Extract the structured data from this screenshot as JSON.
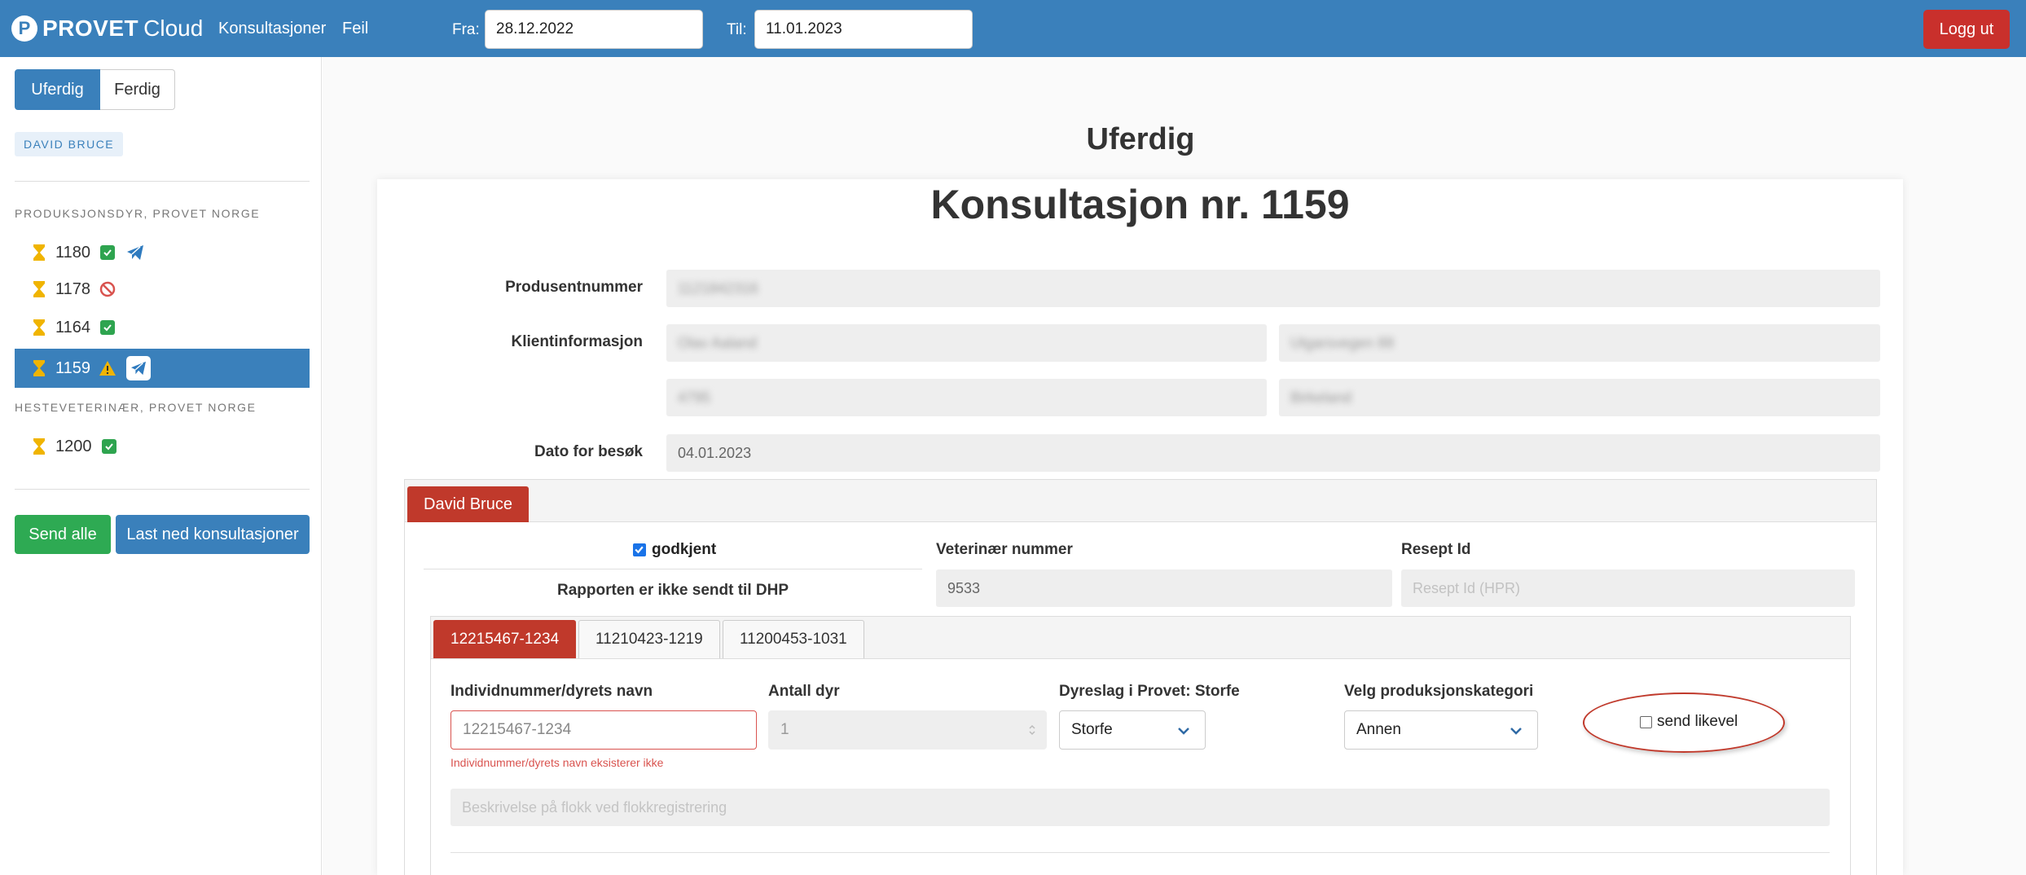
{
  "navbar": {
    "brand_bold": "PROVET",
    "brand_light": "Cloud",
    "logo_letter": "P",
    "links": [
      "Konsultasjoner",
      "Feil"
    ],
    "from_label": "Fra:",
    "from_value": "28.12.2022",
    "to_label": "Til:",
    "to_value": "11.01.2023",
    "logout": "Logg ut"
  },
  "sidebar": {
    "tabs": [
      "Uferdig",
      "Ferdig"
    ],
    "active_tab": "Uferdig",
    "user_tag": "DAVID BRUCE",
    "groups": [
      {
        "title": "PRODUKSJONSDYR, PROVET NORGE",
        "items": [
          {
            "number": "1180",
            "icons": [
              "check-icon",
              "paper-plane-icon"
            ]
          },
          {
            "number": "1178",
            "icons": [
              "prohibited-icon"
            ]
          },
          {
            "number": "1164",
            "icons": [
              "check-icon"
            ]
          },
          {
            "number": "1159",
            "icons": [
              "warning-icon",
              "paper-plane-icon"
            ],
            "active": true
          }
        ]
      },
      {
        "title": "HESTEVETERINÆR, PROVET NORGE",
        "items": [
          {
            "number": "1200",
            "icons": [
              "check-icon"
            ]
          }
        ]
      }
    ],
    "send_all": "Send alle",
    "download": "Last ned konsultasjoner"
  },
  "main": {
    "status_title": "Uferdig",
    "consultation_title": "Konsultasjon nr. 1159",
    "labels": {
      "producer_number": "Produsentnummer",
      "client_info": "Klientinformasjon",
      "visit_date": "Dato for besøk"
    },
    "visit_date_value": "04.01.2023",
    "vet_tab": "David Bruce",
    "approved_label": "godkjent",
    "approved": true,
    "report_status": "Rapporten er ikke sendt til DHP",
    "vet_number_label": "Veterinær nummer",
    "vet_number_value": "9533",
    "prescription_label": "Resept Id",
    "prescription_placeholder": "Resept Id (HPR)",
    "animal_tabs": [
      "12215467-1234",
      "11210423-1219",
      "11200453-1031"
    ],
    "animal_form": {
      "id_label": "Individnummer/dyrets navn",
      "id_value": "12215467-1234",
      "id_error": "Individnummer/dyrets navn eksisterer ikke",
      "count_label": "Antall dyr",
      "count_value": "1",
      "species_label": "Dyreslag i Provet: Storfe",
      "species_value": "Storfe",
      "category_label": "Velg produksjonskategori",
      "category_value": "Annen",
      "send_anyway": "send likevel",
      "description_placeholder": "Beskrivelse på flokk ved flokkregistrering"
    }
  },
  "colors": {
    "primary": "#3a80bb",
    "danger": "#c0392b",
    "success": "#2eaa53",
    "warning": "#f0b400"
  }
}
